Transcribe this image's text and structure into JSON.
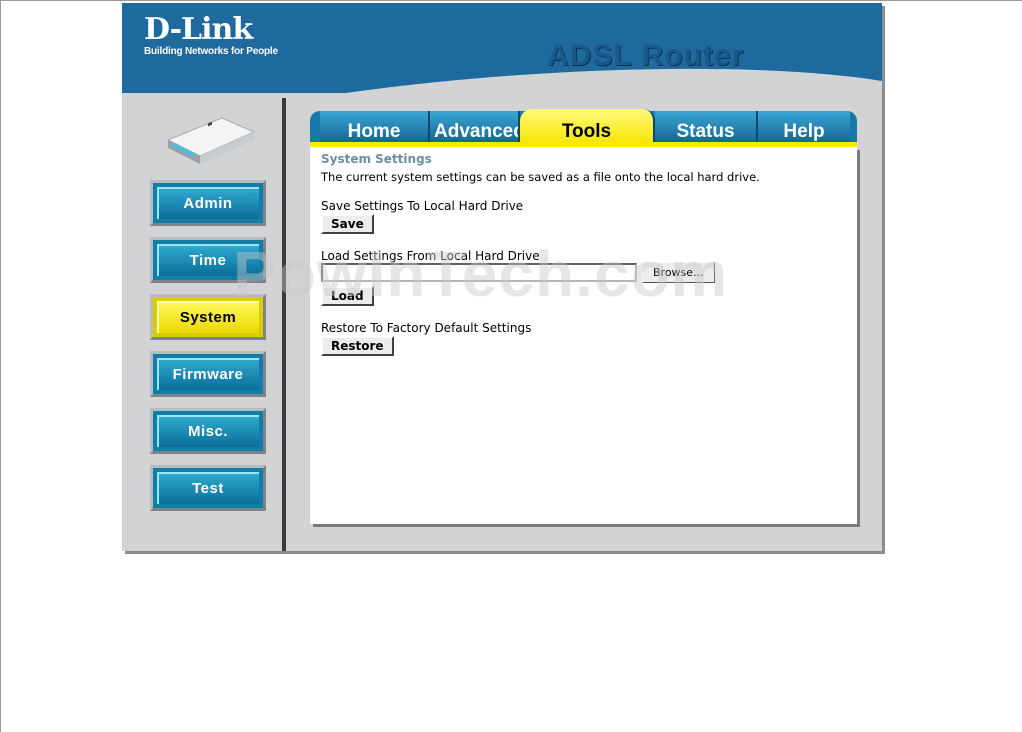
{
  "header": {
    "brand": "D-Link",
    "tagline": "Building Networks for People",
    "product_title": "ADSL Router"
  },
  "sidebar": {
    "items": [
      {
        "label": "Admin",
        "active": false
      },
      {
        "label": "Time",
        "active": false
      },
      {
        "label": "System",
        "active": true
      },
      {
        "label": "Firmware",
        "active": false
      },
      {
        "label": "Misc.",
        "active": false
      },
      {
        "label": "Test",
        "active": false
      }
    ]
  },
  "tabs": [
    {
      "label": "Home",
      "active": false
    },
    {
      "label": "Advanced",
      "active": false
    },
    {
      "label": "Tools",
      "active": true
    },
    {
      "label": "Status",
      "active": false
    },
    {
      "label": "Help",
      "active": false
    }
  ],
  "main": {
    "section_title": "System Settings",
    "description": "The current system settings can be saved as a file onto the local hard drive.",
    "save": {
      "label": "Save Settings To Local Hard Drive",
      "button": "Save"
    },
    "load": {
      "label": "Load Settings From Local Hard Drive",
      "file_value": "",
      "browse_button": "Browse...",
      "button": "Load"
    },
    "restore": {
      "label": "Restore To Factory Default Settings",
      "button": "Restore"
    }
  },
  "watermark": "PowInTech.com",
  "colors": {
    "brand_blue": "#1e6a9f",
    "active_yellow": "#f5e400",
    "frame_gray": "#d2d3d5"
  }
}
